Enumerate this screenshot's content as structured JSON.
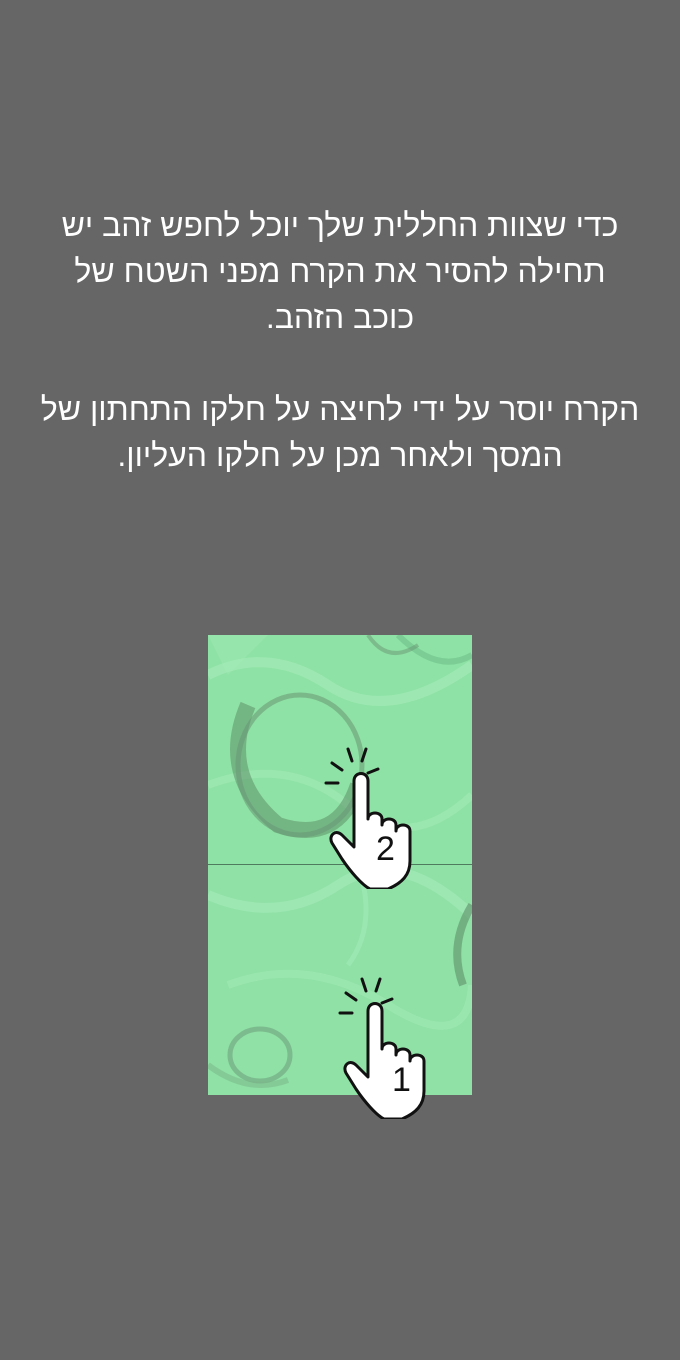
{
  "instructions": {
    "paragraph_1": "כדי שצוות החללית שלך יוכל לחפש זהב יש תחילה להסיר את הקרח מפני השטח של כוכב הזהב.",
    "paragraph_2": "הקרח יוסר על ידי לחיצה על חלקו התחתון של המסך ולאחר מכן על חלקו העליון."
  },
  "illustration": {
    "top_step_number": "2",
    "bottom_step_number": "1",
    "top_hand_icon": "tap-hand-icon",
    "bottom_hand_icon": "tap-hand-icon"
  },
  "colors": {
    "background": "#666666",
    "ice": "#8fe0a6",
    "text": "#ffffff"
  }
}
